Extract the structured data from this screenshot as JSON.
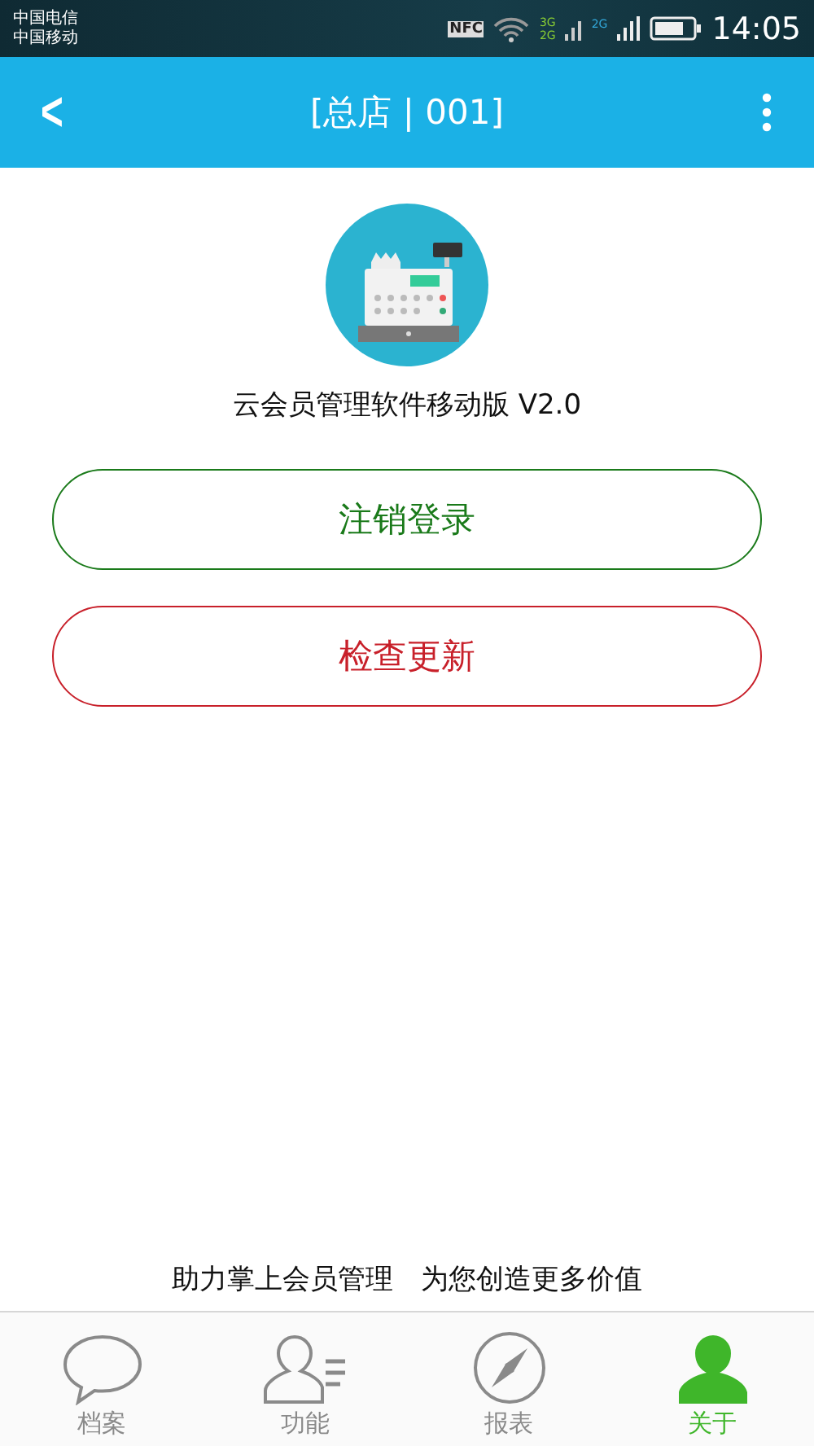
{
  "status_bar": {
    "carriers": [
      "中国电信",
      "中国移动"
    ],
    "network_labels": [
      "3G",
      "2G",
      "2G"
    ],
    "nfc": "NFC",
    "time": "14:05"
  },
  "app_bar": {
    "back": "<",
    "title": "[总店 | 001]"
  },
  "about": {
    "app_name": "云会员管理软件移动版 V2.0"
  },
  "buttons": [
    {
      "label": "注销登录",
      "color": "#1a7a1a"
    },
    {
      "label": "检查更新",
      "color": "#c8202a"
    }
  ],
  "slogan": "助力掌上会员管理　为您创造更多价值",
  "tabs": [
    {
      "label": "档案",
      "selected": false
    },
    {
      "label": "功能",
      "selected": false
    },
    {
      "label": "报表",
      "selected": false
    },
    {
      "label": "关于",
      "selected": true
    }
  ]
}
